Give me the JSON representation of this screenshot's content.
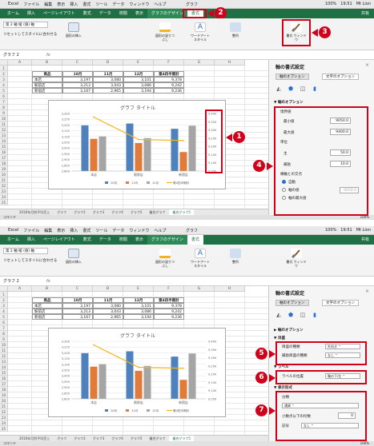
{
  "menubar": {
    "app": "Excel",
    "items": [
      "ファイル",
      "編集",
      "表示",
      "挿入",
      "書式",
      "ツール",
      "データ",
      "ウィンドウ",
      "ヘルプ"
    ],
    "window_title": "グラフ",
    "battery": "100%",
    "clock": "19:51",
    "user": "Mt Lion"
  },
  "ribbon": {
    "tabs": [
      "ホーム",
      "挿入",
      "ページレイアウト",
      "数式",
      "データ",
      "校閲",
      "表示",
      "グラフのデザイン",
      "書式"
    ],
    "active_tab": "書式",
    "account": "共有",
    "element_selector": "第 2 軸 縦 (値) 軸",
    "reset_label": "リセットしてスタイルに合わせる",
    "buttons": {
      "shape": "図形の挿入",
      "fill": "図形の塗りつぶし",
      "wordart": "ワードアート スタイル",
      "arrange": "整列",
      "pane": "書式 ウィンドウ"
    }
  },
  "formula_bar": {
    "name_box": "グラフ 2",
    "fx": "fx"
  },
  "columns": [
    "A",
    "B",
    "C",
    "D",
    "E",
    "F",
    "G",
    "H"
  ],
  "rows": [
    "1",
    "2",
    "3",
    "4",
    "5",
    "6",
    "7",
    "8",
    "9",
    "10",
    "11",
    "12",
    "13",
    "14",
    "15",
    "16",
    "17",
    "18",
    "19",
    "20",
    "21",
    "22",
    "23",
    "24",
    "25"
  ],
  "table": {
    "headers": [
      "商品",
      "10月",
      "11月",
      "12月",
      "第4四半期計"
    ],
    "rows": [
      [
        "本店",
        "3,197",
        "3,080",
        "3,101",
        "9,378"
      ],
      [
        "駅前店",
        "3,213",
        "3,043",
        "3,086",
        "9,242"
      ],
      [
        "新宿店",
        "3,167",
        "2,965",
        "3,194",
        "9,236"
      ]
    ]
  },
  "chart_data": {
    "type": "bar",
    "title": "グラフ タイトル",
    "categories": [
      "本店",
      "駅前店",
      "新宿店"
    ],
    "series": [
      {
        "name": "10月",
        "type": "bar",
        "color": "#4f81bd",
        "values": [
          3197,
          3213,
          3167
        ]
      },
      {
        "name": "11月",
        "type": "bar",
        "color": "#e07b39",
        "values": [
          3080,
          3043,
          2965
        ]
      },
      {
        "name": "12月",
        "type": "bar",
        "color": "#a5a5a5",
        "values": [
          3101,
          3086,
          3194
        ]
      },
      {
        "name": "第4四半期計",
        "type": "line",
        "axis": "secondary",
        "color": "#f2b51c",
        "values": [
          9378,
          9242,
          9236
        ]
      }
    ],
    "ylim": [
      2800,
      3300
    ],
    "y_ticks": [
      "3,300",
      "3,250",
      "3,200",
      "3,150",
      "3,100",
      "3,050",
      "3,000",
      "2,950",
      "2,900",
      "2,850",
      "2,800"
    ],
    "y2lim": [
      9050,
      9400
    ],
    "y2_ticks": [
      "9,400",
      "9,350",
      "9,300",
      "9,250",
      "9,200",
      "9,150",
      "9,100",
      "9,050"
    ],
    "legend": "bottom"
  },
  "sheet_tabs": [
    "2016年月別平均売上",
    "グラフ",
    "グラフ2",
    "グラフ3",
    "グラフ4",
    "グラフ5",
    "複合グラフ",
    "複合グラフ5"
  ],
  "active_sheet": "複合グラフ5",
  "status": {
    "mode": "コマンド",
    "zoom": "100%"
  },
  "pane": {
    "title": "軸の書式設定",
    "tabs": [
      "軸のオプション",
      "文字のオプション"
    ],
    "icons": [
      "paint-bucket-icon",
      "pentagon-icon",
      "size-icon",
      "bar-chart-icon"
    ],
    "screen1": {
      "section": "軸のオプション",
      "bounds_label": "境界値",
      "min_label": "最小値",
      "min_value": "9050.0",
      "max_label": "最大値",
      "max_value": "9400.0",
      "units_label": "単位",
      "major_label": "主",
      "major_value": "50.0",
      "minor_label": "補助",
      "minor_value": "10.0",
      "cross_label": "横軸との交点",
      "cross_auto": "自動",
      "cross_value": "軸の値",
      "cross_max": "軸の最大値",
      "cross_input": "9050.0"
    },
    "screen2": {
      "section_axis": "軸のオプション",
      "section_ticks": "目盛",
      "major_tick_label": "目盛の種類",
      "major_tick_value": "外向き",
      "minor_tick_label": "補助目盛の種類",
      "minor_tick_value": "なし",
      "section_labels": "ラベル",
      "label_pos_label": "ラベルの位置",
      "label_pos_value": "軸の下/左",
      "section_numbers": "表示形式",
      "category_label": "分類",
      "category_value": "通貨",
      "decimal_label": "小数点以下の桁数",
      "decimal_value": "0",
      "symbol_label": "記号",
      "symbol_value": "なし"
    }
  },
  "callouts": [
    "1",
    "2",
    "3",
    "4",
    "5",
    "6",
    "7"
  ]
}
